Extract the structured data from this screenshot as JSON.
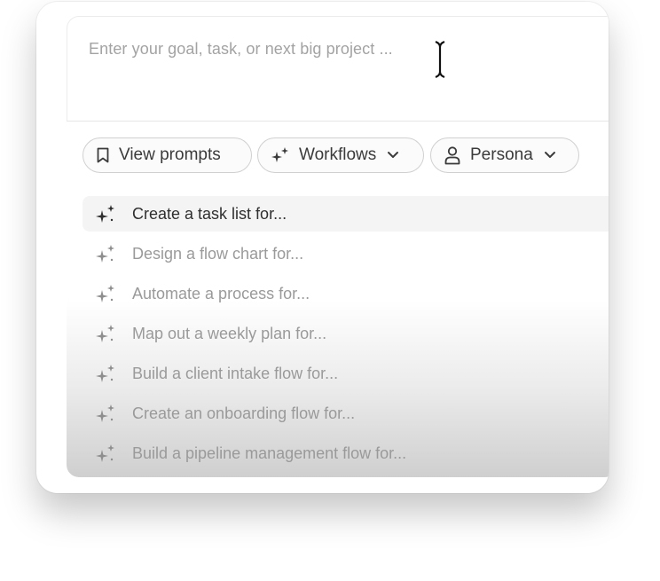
{
  "prompt_input": {
    "placeholder": "Enter your goal, task, or next big project ..."
  },
  "chips": [
    {
      "label": "View prompts",
      "icon": "bookmark-icon"
    },
    {
      "label": "Workflows",
      "icon": "sparkles-icon",
      "dropdown": true
    },
    {
      "label": "Persona",
      "icon": "person-icon",
      "dropdown": true
    }
  ],
  "suggestions": [
    {
      "label": "Create a task list for...",
      "active": true
    },
    {
      "label": "Design a flow chart for..."
    },
    {
      "label": "Automate a process for..."
    },
    {
      "label": "Map out a weekly plan for..."
    },
    {
      "label": "Build a client intake flow for..."
    },
    {
      "label": "Create an onboarding flow for..."
    },
    {
      "label": "Build a pipeline management flow for..."
    }
  ],
  "colors": {
    "text_active": "#2f2f2f",
    "text_muted": "#9a9a9a",
    "placeholder": "#a3a3a3",
    "chip_border": "#d0d0d0"
  }
}
